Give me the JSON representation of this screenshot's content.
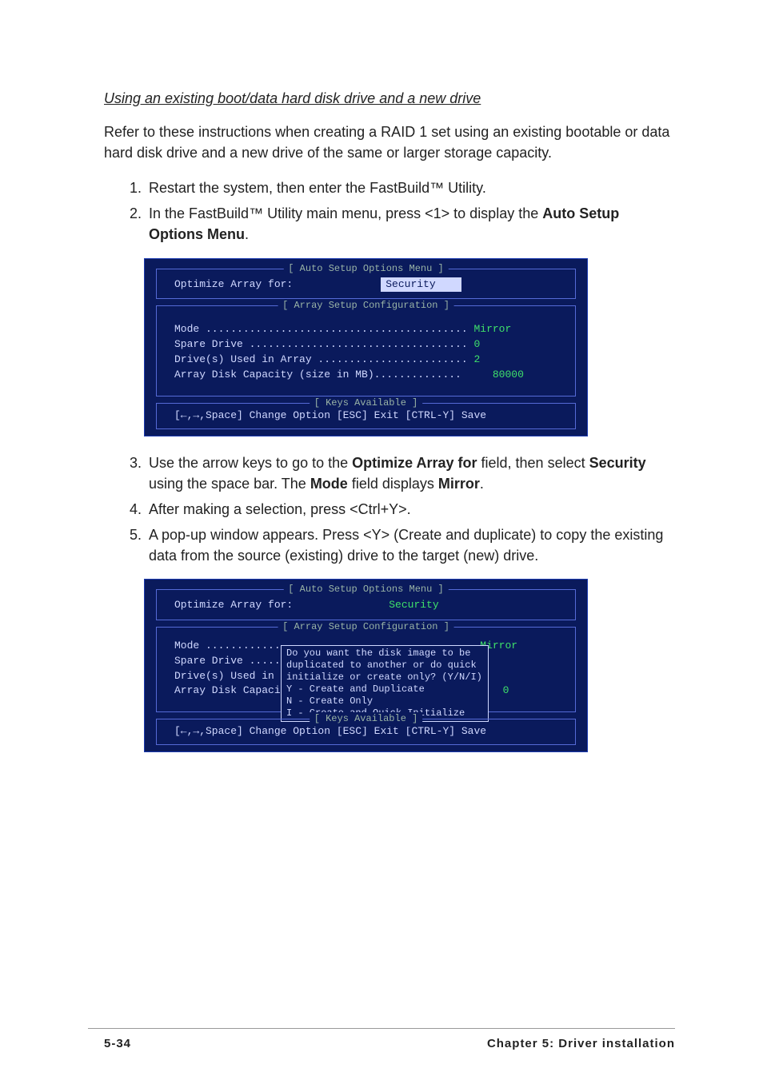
{
  "heading": "Using an existing boot/data hard disk drive and a new drive",
  "intro": "Refer to these instructions when creating a RAID 1 set using an existing bootable or data hard disk drive and a new drive of the same or larger storage capacity.",
  "steps_top": {
    "s1": "Restart the system, then enter the FastBuild™ Utility.",
    "s2_a": "In the FastBuild™ Utility main menu, press <1> to display the ",
    "s2_b": "Auto Setup Options Menu",
    "s2_c": "."
  },
  "term1": {
    "legend": "[ Auto Setup Options Menu ]",
    "opt_label": "Optimize Array for:",
    "opt_value": "Security",
    "conf_legend": "[ Array Setup Configuration ]",
    "rows": {
      "mode_label": "Mode .......................................... ",
      "mode_val": "Mirror",
      "spare_label": "Spare Drive ................................... ",
      "spare_val": "0",
      "drives_label": "Drive(s) Used in Array ........................ ",
      "drives_val": "2",
      "cap_label": "Array Disk Capacity (size in MB)..............     ",
      "cap_val": "80000"
    },
    "keys_legend": "[ Keys Available ]",
    "footer": "[←,→,Space] Change Option  [ESC] Exit  [CTRL-Y] Save"
  },
  "steps_mid": {
    "s3_a": "Use the arrow keys to go to the ",
    "s3_b": "Optimize Array for",
    "s3_c": " field, then select ",
    "s3_d": "Security",
    "s3_e": " using the space bar. The ",
    "s3_f": "Mode",
    "s3_g": " field displays ",
    "s3_h": "Mirror",
    "s3_i": ".",
    "s4": "After making a selection, press <Ctrl+Y>.",
    "s5": "A pop-up window appears. Press <Y> (Create and duplicate) to copy the existing data from the source (existing) drive to the target (new) drive."
  },
  "term2": {
    "legend": "[ Auto Setup Options Menu ]",
    "opt_label": "Optimize Array for:",
    "opt_value": "Security",
    "conf_legend": "[ Array Setup Configuration ]",
    "rows": {
      "mode_label": "Mode ..........................................  ",
      "mode_val": "Mirror",
      "spare_label": "Spare Drive .....",
      "drives_label": "Drive(s) Used in ",
      "cap_label": "Array Disk Capaci",
      "trail_val": "0"
    },
    "popup_text": "Do you want the disk image to be\nduplicated to another or do quick\ninitialize or create only? (Y/N/I)\nY - Create and Duplicate\nN - Create Only\nI - Create and Quick Initialize",
    "keys_legend": "[ Keys Available ]",
    "footer": "[←,→,Space] Change Option  [ESC] Exit  [CTRL-Y] Save"
  },
  "footer": {
    "pn": "5-34",
    "chapter": "Chapter 5:  Driver installation"
  }
}
